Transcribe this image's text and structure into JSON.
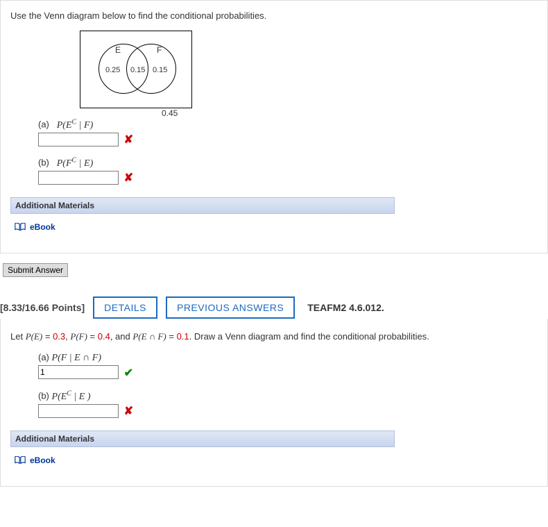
{
  "q1": {
    "instruction": "Use the Venn diagram below to find the conditional probabilities.",
    "venn": {
      "setA_label": "E",
      "setB_label": "F",
      "only_A": "0.25",
      "intersection": "0.15",
      "only_B": "0.15",
      "outside": "0.45"
    },
    "parts": {
      "a": {
        "label": "(a)",
        "expr_prefix": "P(E",
        "expr_sup": "C",
        "expr_suffix": " | F)",
        "value": "",
        "mark": "x"
      },
      "b": {
        "label": "(b)",
        "expr_prefix": "P(F",
        "expr_sup": "C",
        "expr_suffix": " | E)",
        "value": "",
        "mark": "x"
      }
    },
    "materials_header": "Additional Materials",
    "ebook_label": "eBook",
    "submit_label": "Submit Answer"
  },
  "q2": {
    "points": "[8.33/16.66 Points]",
    "details_btn": "DETAILS",
    "prev_btn": "PREVIOUS ANSWERS",
    "ref": "TEAFM2 4.6.012.",
    "text_pre": "Let ",
    "pe_label": "P(E)",
    "pe_eq": " = ",
    "pe_val": "0.3",
    "sep1": ", ",
    "pf_label": "P(F)",
    "pf_eq": " = ",
    "pf_val": "0.4",
    "sep2": ", and ",
    "pef_label": "P(E ∩ F)",
    "pef_eq": " = ",
    "pef_val": "0.1",
    "text_post": ". Draw a Venn diagram and find the conditional probabilities.",
    "parts": {
      "a": {
        "label": "(a)",
        "expr": "P(F | E ∩ F)",
        "value": "1",
        "mark": "check"
      },
      "b": {
        "label": "(b)",
        "expr_prefix": "P(E",
        "expr_sup": "C",
        "expr_suffix": " | E )",
        "value": "",
        "mark": "x"
      }
    },
    "materials_header": "Additional Materials",
    "ebook_label": "eBook"
  }
}
